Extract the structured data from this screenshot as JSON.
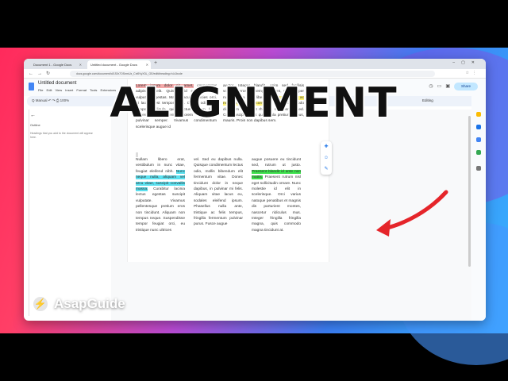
{
  "overlay": {
    "title": "ALIGNMENT",
    "brand": "AsapGuide"
  },
  "browser": {
    "tabs": [
      {
        "label": "Document 1 - Google Docs"
      },
      {
        "label": "Untitled document - Google Docs"
      }
    ],
    "url": "docs.google.com/document/d/1S0r7OSnmUz_Cnl9VyX3L_GE/edit#heading=h.k1bcde"
  },
  "doc": {
    "title": "Untitled document",
    "menus": "File  Edit  View  Insert  Format  Tools  Extensions  Help",
    "share_label": "Share",
    "toolbar_left": "Q  Manual  ↶  ↷  ⎙  100%",
    "toolbar_open": "Open...",
    "editing_label": "Editing"
  },
  "outline": {
    "label": "Outline",
    "hint": "Headings that you add to the document will appear here."
  },
  "page": {
    "c1_hl": "Lorem ipsum dolor sit amet,",
    "c1_rest": " consectetur adipiscing elit. Quisque id enim ut velit vulputate egestas. Mauris iaculis ultricies orci, at laoreet est tempor vitae. Donec odio nisi, tempor a ligula quis, luctus dictum felis. Pellentesque fermentum lorem eget tellus pulvinar semper. Vivamus condimentum scelerisque augue id",
    "c2_pre": "auctor. Integer blandit, enim sed facilisis volutpat, eros leo tempor sapien, sed semper nulla magna quis libero. ",
    "c2_hl": "Donec et metus ac neque consequat convallis.",
    "c2_post": " Donec commodo dignissim lectus, ut rhoncus mi euismod sed. Cras suscipit id est quis ligula pretium finibus, mauris. Proin non dapibus sem.",
    "c3_pre": "Nullam libero erat, vestibulum in nunc vitae, feugiat eleifend nibh. ",
    "c3_hl": "Nunc neque nulla, aliquam vel arcu vitae, suscipit convallis massa.",
    "c3_post": " Curabitur lacinia lectus egestas suscipit vulputate. Vivamus pellentesque pretium eros non tincidunt. Aliquam non tempus neque. Suspendisse tempor feugiat orci, eu tristique nunc ultrices",
    "c4": "vel. Sed eu dapibus nulla. Quisque condimentum lectus odio, mollis bibendum elit fermentum vitae. Donec tincidunt dolor in neque dapibus, in pulvinar mi felis. Aliquam vitae lacus eu, sodales eleifend ipsum. Phasellus nulla ante, tristique ac felis tempus, fringilla fermentum pulvinar purus. Fusce augue",
    "c5_pre": "augue posuere eu tincidunt sed, rutrum ut justo. ",
    "c5_hl": "Praesent blandit id ante non mattis.",
    "c5_post": " Praesent rutrum nisl eget sollicitudin ornare. Nunc molestie id elit in scelerisque. Orci varius natoque penatibus et magnis dis parturient montes, nascetur ridiculus mus. Integer fringilla fringilla magna, quis commodo magna tincidunt at."
  },
  "colors": {
    "highlight_red": "#f4a9a9",
    "highlight_yellow": "#fff36b",
    "highlight_cyan": "#5ce1f0",
    "highlight_green": "#3de24c",
    "arrow_red": "#e5252a",
    "share_bg": "#c2e7ff"
  }
}
